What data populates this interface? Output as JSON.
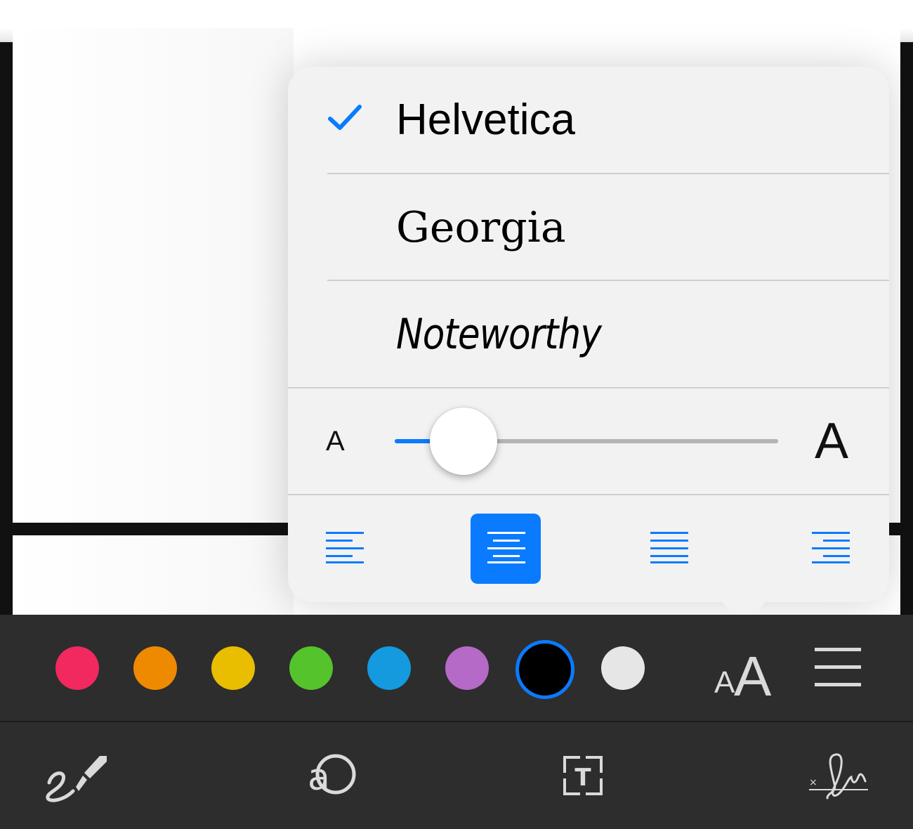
{
  "popover": {
    "fonts": [
      {
        "label": "Helvetica",
        "selected": true
      },
      {
        "label": "Georgia",
        "selected": false
      },
      {
        "label": "Noteworthy",
        "selected": false
      }
    ],
    "size_slider": {
      "small_label": "A",
      "large_label": "A",
      "value_fraction": 0.18
    },
    "alignment": {
      "options": [
        "align-left",
        "align-center",
        "align-justify",
        "align-right"
      ],
      "selected": "align-center"
    }
  },
  "color_toolbar": {
    "swatches": [
      {
        "name": "pink",
        "color": "#f2295e"
      },
      {
        "name": "orange",
        "color": "#ee8a00"
      },
      {
        "name": "yellow",
        "color": "#e9be00"
      },
      {
        "name": "green",
        "color": "#55c32c"
      },
      {
        "name": "blue",
        "color": "#1599df"
      },
      {
        "name": "purple",
        "color": "#b46ac6"
      },
      {
        "name": "black",
        "color": "#000000",
        "selected": true
      },
      {
        "name": "light-gray",
        "color": "#e6e6e6"
      }
    ],
    "font_size_icon": {
      "small": "A",
      "large": "A"
    },
    "menu_icon": "hamburger-icon"
  },
  "tool_bar": {
    "tools": [
      "sketch-icon",
      "magnifier-icon",
      "text-box-icon",
      "signature-icon"
    ]
  },
  "colors": {
    "accent": "#0a7bff",
    "toolbar_bg": "#2d2d2d",
    "popover_bg": "#f2f2f2",
    "icon": "#dadada"
  }
}
